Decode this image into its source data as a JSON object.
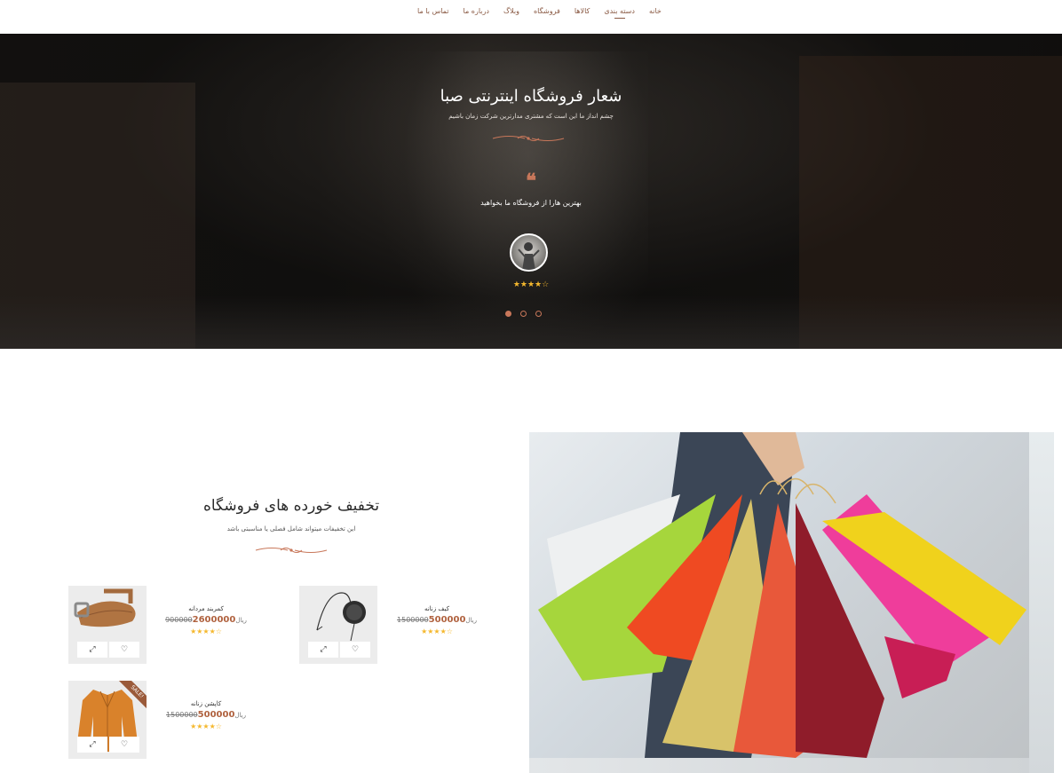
{
  "nav": {
    "items": [
      {
        "label": "خانه",
        "active": false
      },
      {
        "label": "دسته بندی",
        "active": true
      },
      {
        "label": "کالاها",
        "active": false
      },
      {
        "label": "فروشگاه",
        "active": false
      },
      {
        "label": "وبلاگ",
        "active": false
      },
      {
        "label": "درباره ما",
        "active": false
      },
      {
        "label": "تماس با ما",
        "active": false
      }
    ]
  },
  "hero": {
    "title": "شعار فروشگاه اینترنتی صبا",
    "subtitle": "چشم انداز ما این است که مشتری مدارترین شرکت زمان باشیم",
    "quote_icon": "❝",
    "testimonial": "بهترین هارا از فروشگاه ما بخواهید",
    "rating": "★★★★☆",
    "slides": 3,
    "active_slide": 1
  },
  "discount": {
    "title": "تخفیف خورده های فروشگاه",
    "subtitle": "این تخفیفات میتواند شامل فصلی یا مناسبتی باشد",
    "products": [
      {
        "name": "کمربند مردانه",
        "old_price": "900000",
        "new_price": "2600000",
        "currency": "ریال",
        "rating": "★★★★☆",
        "sale": false
      },
      {
        "name": "کیف زنانه",
        "old_price": "1500000",
        "new_price": "500000",
        "currency": "ریال",
        "rating": "★★★★☆",
        "sale": false
      },
      {
        "name": "کاپشن زنانه",
        "old_price": "1500000",
        "new_price": "500000",
        "currency": "ریال",
        "rating": "★★★★☆",
        "sale": true
      }
    ],
    "sale_label": "SALE!",
    "quickview_icon": "expand-icon",
    "wishlist_icon": "heart-icon"
  },
  "colors": {
    "accent": "#c8775a",
    "price": "#b0623f",
    "star": "#f5b82e",
    "nav_text": "#8a5a44"
  }
}
